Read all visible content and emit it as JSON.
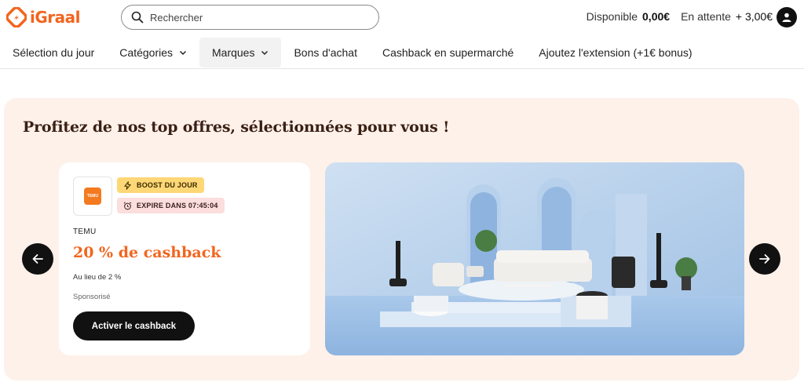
{
  "header": {
    "logo_text": "iGraal",
    "search_placeholder": "Rechercher",
    "balance_available_label": "Disponible",
    "balance_available_value": "0,00€",
    "balance_pending_label": "En attente",
    "balance_pending_value": "+ 3,00€"
  },
  "nav": {
    "items": [
      {
        "label": "Sélection du jour"
      },
      {
        "label": "Catégories"
      },
      {
        "label": "Marques"
      },
      {
        "label": "Bons d'achat"
      },
      {
        "label": "Cashback en supermarché"
      },
      {
        "label": "Ajoutez l'extension (+1€ bonus)"
      }
    ]
  },
  "hero": {
    "title": "Profitez de nos top offres, sélectionnées pour vous !",
    "offer": {
      "brand_logo_text": "TEMU",
      "badge_boost": "BOOST DU JOUR",
      "badge_expire": "EXPIRE DANS 07:45:04",
      "brand_name": "TEMU",
      "cashback": "20 % de cashback",
      "instead": "Au lieu de 2 %",
      "sponsored": "Sponsorisé",
      "cta": "Activer le cashback"
    }
  },
  "colors": {
    "brand_orange": "#f2651e",
    "hero_bg": "#fdf1ea",
    "boost_badge": "#fed776",
    "expire_badge": "#fbdedd",
    "dark": "#111111"
  },
  "icons": [
    "igraal-logo-icon",
    "search-icon",
    "user-icon",
    "chevron-down-icon",
    "arrow-left-icon",
    "arrow-right-icon",
    "lightning-icon",
    "alarm-clock-icon"
  ]
}
